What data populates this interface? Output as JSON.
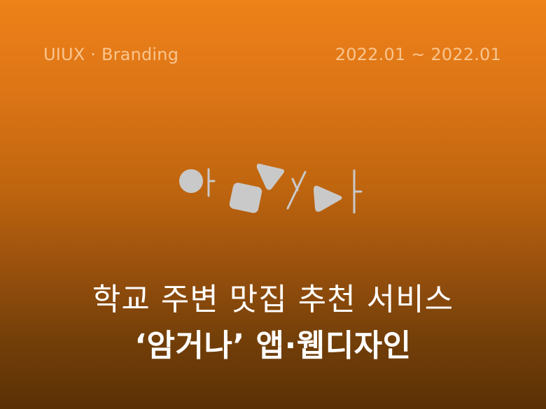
{
  "header": {
    "category": "UIUX · Branding",
    "period": "2022.01 ~ 2022.01"
  },
  "logo": {
    "name": "amgeona-wordmark-logo",
    "text": "암거나"
  },
  "title": {
    "line1": "학교 주변 맛집 추천 서비스",
    "line2": "‘암거나’ 앱·웹디자인"
  },
  "colors": {
    "gradient_top": "#ee8219",
    "gradient_bottom": "#5a3005",
    "logo_fill": "#c9c9c9",
    "meta_text": "#ffd6aa",
    "title_text": "#ffffff"
  }
}
